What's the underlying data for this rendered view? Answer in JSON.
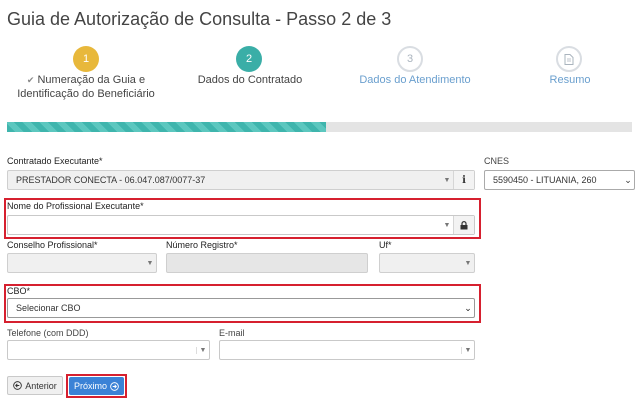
{
  "page": {
    "title": "Guia de Autorização de Consulta - Passo 2 de 3"
  },
  "steps": [
    {
      "number": "1",
      "check": "✔",
      "label_line1": "Numeração da Guia e",
      "label_line2": "Identificação do Beneficiário",
      "color": "#e8b83b"
    },
    {
      "number": "2",
      "label": "Dados do Contratado",
      "color": "#3aaea7"
    },
    {
      "number": "3",
      "label": "Dados do Atendimento",
      "color": "#d9dde2"
    },
    {
      "label": "Resumo",
      "color": "#d9dde2"
    }
  ],
  "progress": {
    "percent": 51
  },
  "form": {
    "contratado": {
      "label": "Contratado Executante*",
      "value": "PRESTADOR CONECTA - 06.047.087/0077-37",
      "info": "i"
    },
    "cnes": {
      "label": "CNES",
      "value": "5590450 - LITUANIA, 260"
    },
    "profissional": {
      "label": "Nome do Profissional Executante*",
      "value": ""
    },
    "conselho": {
      "label": "Conselho Profissional*",
      "value": ""
    },
    "registro": {
      "label": "Número Registro*",
      "value": ""
    },
    "uf": {
      "label": "Uf*",
      "value": ""
    },
    "cbo": {
      "label": "CBO*",
      "value": "Selecionar CBO"
    },
    "telefone": {
      "label": "Telefone (com DDD)",
      "value": ""
    },
    "email": {
      "label": "E-mail",
      "value": ""
    }
  },
  "buttons": {
    "anterior": "Anterior",
    "proximo": "Próximo"
  },
  "colors": {
    "primary": "#3b82d6",
    "highlight": "#d6202f",
    "link_step": "#6a9fce"
  }
}
